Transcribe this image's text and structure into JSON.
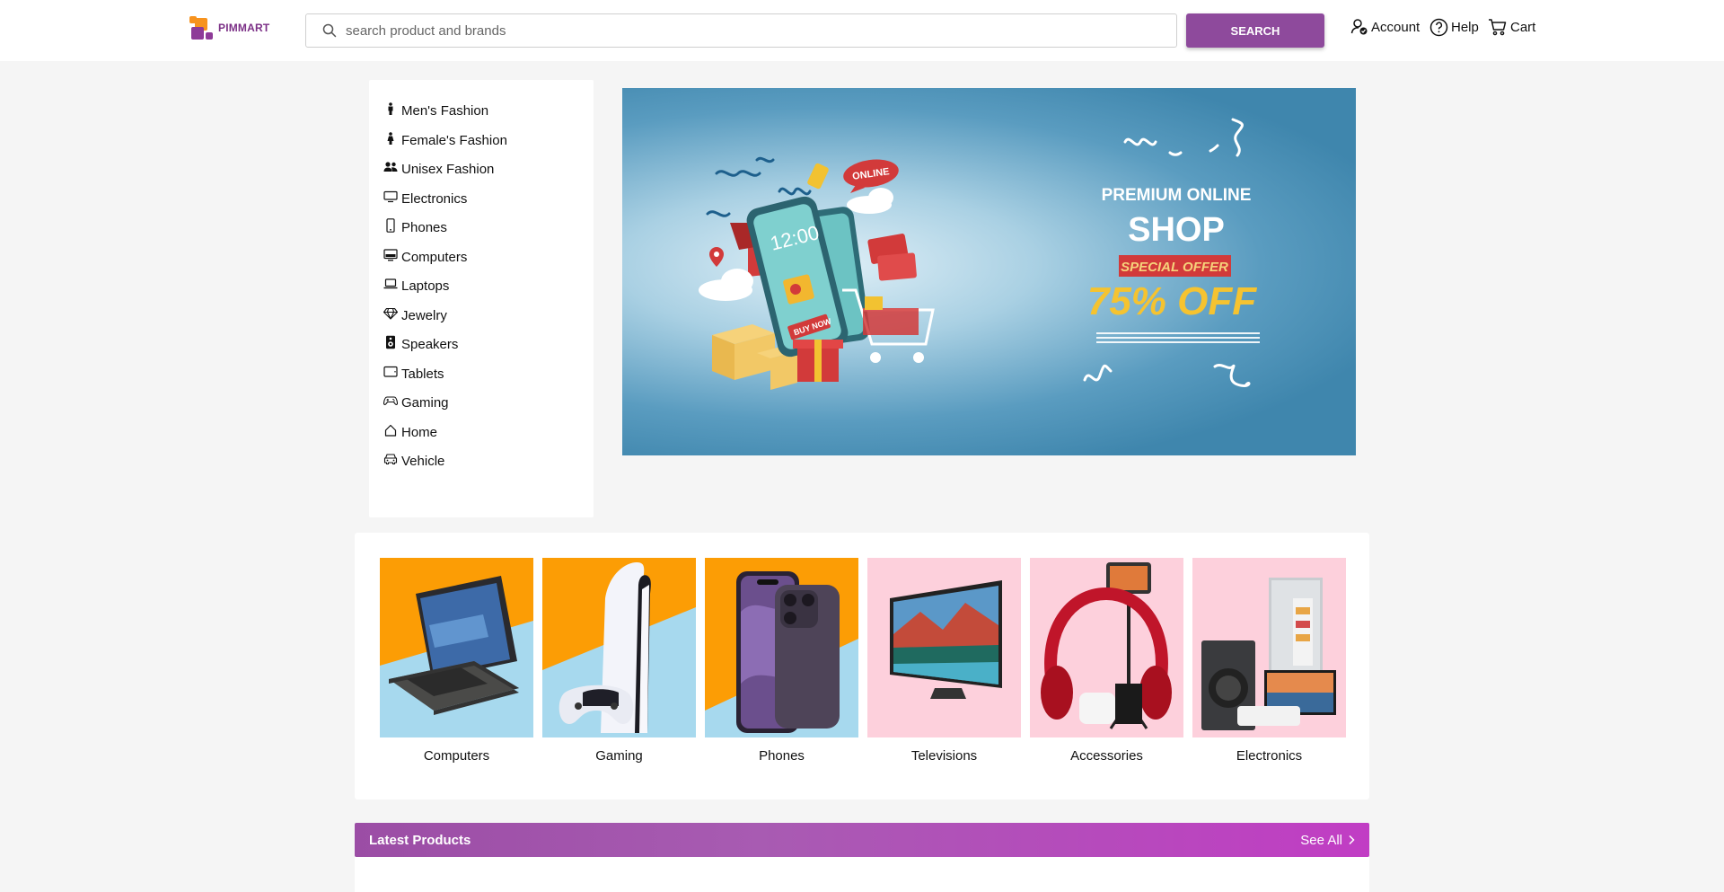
{
  "header": {
    "logo_text": "PIMMART",
    "search": {
      "placeholder": "search product and brands",
      "button_label": "SEARCH"
    },
    "nav": {
      "account_label": "Account",
      "help_label": "Help",
      "cart_label": "Cart"
    }
  },
  "sidebar": {
    "items": [
      {
        "label": "Men's Fashion",
        "icon": "male-icon"
      },
      {
        "label": "Female's Fashion",
        "icon": "female-icon"
      },
      {
        "label": "Unisex Fashion",
        "icon": "people-icon"
      },
      {
        "label": "Electronics",
        "icon": "monitor-icon"
      },
      {
        "label": "Phones",
        "icon": "phone-icon"
      },
      {
        "label": "Computers",
        "icon": "desktop-icon"
      },
      {
        "label": "Laptops",
        "icon": "laptop-icon"
      },
      {
        "label": "Jewelry",
        "icon": "gem-icon"
      },
      {
        "label": "Speakers",
        "icon": "speaker-icon"
      },
      {
        "label": "Tablets",
        "icon": "tablet-icon"
      },
      {
        "label": "Gaming",
        "icon": "controller-icon"
      },
      {
        "label": "Home",
        "icon": "house-icon"
      },
      {
        "label": "Vehicle",
        "icon": "car-icon"
      }
    ]
  },
  "banner": {
    "line1": "PREMIUM ONLINE",
    "line2": "SHOP",
    "tag": "SPECIAL OFFER",
    "discount": "75% OFF",
    "bubble": "ONLINE",
    "buy_now": "BUY NOW",
    "clock": "12:00"
  },
  "categories": [
    {
      "label": "Computers"
    },
    {
      "label": "Gaming"
    },
    {
      "label": "Phones"
    },
    {
      "label": "Televisions"
    },
    {
      "label": "Accessories"
    },
    {
      "label": "Electronics"
    }
  ],
  "latest": {
    "title": "Latest Products",
    "see_all": "See All"
  },
  "colors": {
    "brand_purple": "#8e4a9c",
    "brand_orange": "#f7931e",
    "banner_blue": "#3f86ad"
  }
}
